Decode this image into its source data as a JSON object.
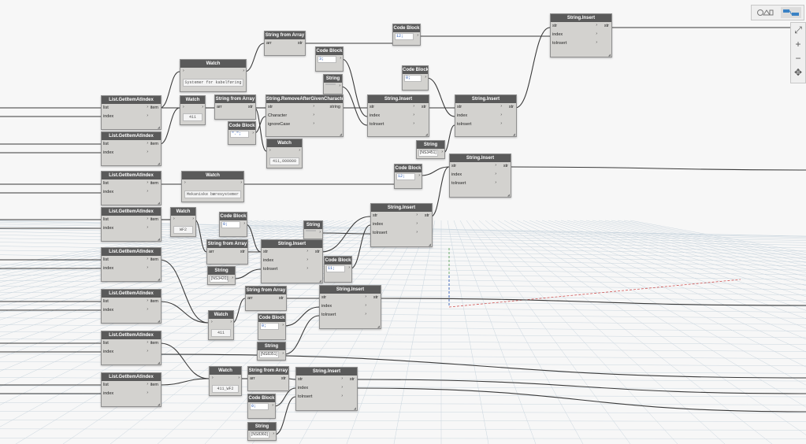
{
  "toolbar": {
    "geometry_view_icon": "geometry-view-icon",
    "graph_view_icon": "graph-view-icon"
  },
  "zoom": {
    "fit_label": "⤢",
    "zoom_in_label": "+",
    "zoom_out_label": "−",
    "pan_label": "✥"
  },
  "labels": {
    "list": "list",
    "index": "index",
    "item": "item",
    "str": "str",
    "arr": "arr",
    "toInsert": "toInsert",
    "string": "string",
    "character": "Character",
    "ignore_case": "ignoreCase"
  },
  "nodes": {
    "get1": {
      "title": "List.GetItemAtIndex"
    },
    "get2": {
      "title": "List.GetItemAtIndex"
    },
    "get3": {
      "title": "List.GetItemAtIndex"
    },
    "get4": {
      "title": "List.GetItemAtIndex"
    },
    "get5": {
      "title": "List.GetItemAtIndex"
    },
    "get6": {
      "title": "List.GetItemAtIndex"
    },
    "get7": {
      "title": "List.GetItemAtIndex"
    },
    "get8": {
      "title": "List.GetItemAtIndex"
    },
    "watch1": {
      "title": "Watch",
      "value": "Systemer for kabelføring"
    },
    "watch2": {
      "title": "Watch",
      "value": "411"
    },
    "watch3": {
      "title": "Watch",
      "value": "411,000000"
    },
    "watch4": {
      "title": "Watch",
      "value": "Mekaniske bæresystemer"
    },
    "watch5": {
      "title": "Watch",
      "value": "WF2"
    },
    "watch6": {
      "title": "Watch",
      "value": "411"
    },
    "watch7": {
      "title": "Watch",
      "value": "411_WF2"
    },
    "sfa1": {
      "title": "String from Array"
    },
    "sfa2": {
      "title": "String from Array"
    },
    "sfa3": {
      "title": "String from Array"
    },
    "sfa4": {
      "title": "String from Array"
    },
    "sfa5": {
      "title": "String from Array"
    },
    "cb1": {
      "title": "Code Block",
      "code": "12;"
    },
    "cb2": {
      "title": "Code Block",
      "code": "3;"
    },
    "cb3": {
      "title": "Code Block",
      "code": "0;"
    },
    "cb4": {
      "title": "Code Block",
      "code": "\".\";"
    },
    "cb5": {
      "title": "Code Block",
      "code": "12;"
    },
    "cb6": {
      "title": "Code Block",
      "code": "0;"
    },
    "cb7": {
      "title": "Code Block",
      "code": "11;"
    },
    "cb8": {
      "title": "Code Block",
      "code": "0;"
    },
    "cb9": {
      "title": "Code Block",
      "code": "0;"
    },
    "str1": {
      "title": "String",
      "value": ""
    },
    "str2": {
      "title": "String",
      "value": "[NS3451]"
    },
    "str3": {
      "title": "String",
      "value": ""
    },
    "str4": {
      "title": "String",
      "value": "[NS3420]"
    },
    "str5": {
      "title": "String",
      "value": "[NS8351]"
    },
    "str6": {
      "title": "String",
      "value": "[NS8360]"
    },
    "remove": {
      "title": "String.RemoveAfterGivenCharacter"
    },
    "ins1": {
      "title": "String.Insert"
    },
    "ins2": {
      "title": "String.Insert"
    },
    "ins3": {
      "title": "String.Insert"
    },
    "ins4": {
      "title": "String.Insert"
    },
    "ins5": {
      "title": "String.Insert"
    },
    "ins6": {
      "title": "String.Insert"
    },
    "ins7": {
      "title": "String.Insert"
    },
    "ins8": {
      "title": "String.Insert"
    }
  }
}
